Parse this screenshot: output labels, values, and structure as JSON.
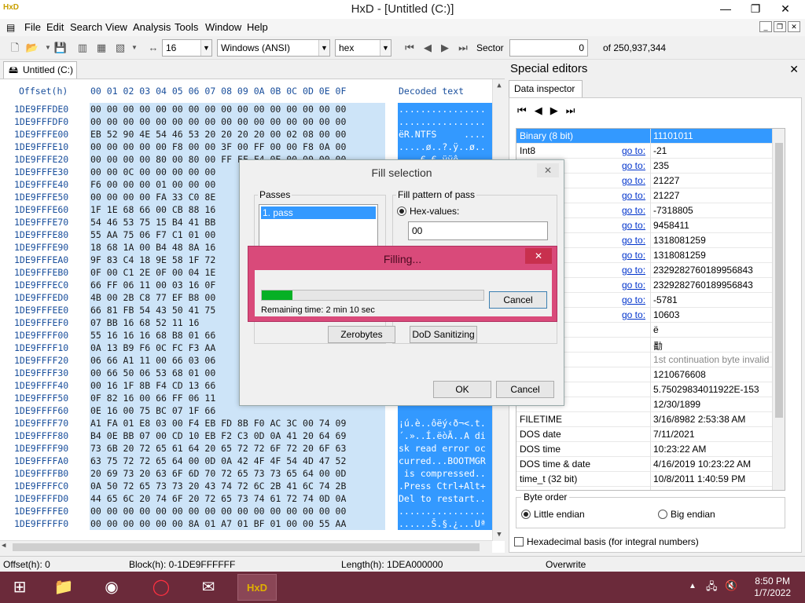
{
  "window": {
    "title": "HxD - [Untitled (C:)]",
    "app_icon": "HxD",
    "controls": {
      "minimize": "—",
      "restore": "❐",
      "close": "✕"
    }
  },
  "menu": [
    "File",
    "Edit",
    "Search",
    "View",
    "Analysis",
    "Tools",
    "Window",
    "Help"
  ],
  "toolbar": {
    "bytes_per_row": "16",
    "charset": "Windows (ANSI)",
    "offset_base": "hex",
    "sector_label": "Sector",
    "sector_value": "0",
    "sector_total": "of 250,937,344"
  },
  "document_tab": "Untitled (C:)",
  "hex": {
    "offset_header": "Offset(h)",
    "columns": "00 01 02 03 04 05 06 07 08 09 0A 0B 0C 0D 0E 0F",
    "decoded_header": "Decoded text",
    "rows": [
      {
        "offset": "1DE9FFFDE0",
        "bytes": "00 00 00 00 00 00 00 00 00 00 00 00 00 00 00 00",
        "text": "................"
      },
      {
        "offset": "1DE9FFFDF0",
        "bytes": "00 00 00 00 00 00 00 00 00 00 00 00 00 00 00 00",
        "text": "................"
      },
      {
        "offset": "1DE9FFFE00",
        "bytes": "EB 52 90 4E 54 46 53 20 20 20 20 00 02 08 00 00",
        "text": "ëR.NTFS     ...."
      },
      {
        "offset": "1DE9FFFE10",
        "bytes": "00 00 00 00 00 F8 00 00 3F 00 FF 00 00 F8 0A 00",
        "text": ".....ø..?.ÿ..ø.."
      },
      {
        "offset": "1DE9FFFE20",
        "bytes": "00 00 00 00 80 00 80 00 FF FF F4 0E 00 00 00 00",
        "text": "....€.€.ÿÿô....."
      },
      {
        "offset": "1DE9FFFE30",
        "bytes": "00 00 0C 00 00 00 00 00",
        "text": ""
      },
      {
        "offset": "1DE9FFFE40",
        "bytes": "F6 00 00 00 01 00 00 00",
        "text": ""
      },
      {
        "offset": "1DE9FFFE50",
        "bytes": "00 00 00 00 FA 33 C0 8E",
        "text": ""
      },
      {
        "offset": "1DE9FFFE60",
        "bytes": "1F 1E 68 66 00 CB 88 16",
        "text": ""
      },
      {
        "offset": "1DE9FFFE70",
        "bytes": "54 46 53 75 15 B4 41 BB",
        "text": ""
      },
      {
        "offset": "1DE9FFFE80",
        "bytes": "55 AA 75 06 F7 C1 01 00",
        "text": ""
      },
      {
        "offset": "1DE9FFFE90",
        "bytes": "18 68 1A 00 B4 48 8A 16",
        "text": ""
      },
      {
        "offset": "1DE9FFFEA0",
        "bytes": "9F 83 C4 18 9E 58 1F 72",
        "text": ""
      },
      {
        "offset": "1DE9FFFEB0",
        "bytes": "0F 00 C1 2E 0F 00 04 1E",
        "text": ""
      },
      {
        "offset": "1DE9FFFEC0",
        "bytes": "66 FF 06 11 00 03 16 0F",
        "text": ""
      },
      {
        "offset": "1DE9FFFED0",
        "bytes": "4B 00 2B C8 77 EF B8 00",
        "text": ""
      },
      {
        "offset": "1DE9FFFEE0",
        "bytes": "66 81 FB 54 43 50 41 75",
        "text": ""
      },
      {
        "offset": "1DE9FFFEF0",
        "bytes": "07 BB 16 68 52 11 16",
        "text": ""
      },
      {
        "offset": "1DE9FFFF00",
        "bytes": "55 16 16 16 68 B8 01 66",
        "text": ""
      },
      {
        "offset": "1DE9FFFF10",
        "bytes": "0A 13 B9 F6 0C FC F3 AA",
        "text": ""
      },
      {
        "offset": "1DE9FFFF20",
        "bytes": "06 66 A1 11 00 66 03 06",
        "text": ""
      },
      {
        "offset": "1DE9FFFF30",
        "bytes": "00 66 50 06 53 68 01 00",
        "text": ""
      },
      {
        "offset": "1DE9FFFF40",
        "bytes": "00 16 1F 8B F4 CD 13 66",
        "text": ""
      },
      {
        "offset": "1DE9FFFF50",
        "bytes": "0F 82 16 00 66 FF 06 11",
        "text": ""
      },
      {
        "offset": "1DE9FFFF60",
        "bytes": "0E 16 00 75 BC 07 1F 66",
        "text": ""
      },
      {
        "offset": "1DE9FFFF70",
        "bytes": "A1 FA 01 E8 03 00 F4 EB FD 8B F0 AC 3C 00 74 09",
        "text": "¡ú.è..ôëý‹ð¬<.t."
      },
      {
        "offset": "1DE9FFFF80",
        "bytes": "B4 0E BB 07 00 CD 10 EB F2 C3 0D 0A 41 20 64 69",
        "text": "´.»..Í.ëòÃ..A di"
      },
      {
        "offset": "1DE9FFFF90",
        "bytes": "73 6B 20 72 65 61 64 20 65 72 72 6F 72 20 6F 63",
        "text": "sk read error oc"
      },
      {
        "offset": "1DE9FFFFA0",
        "bytes": "63 75 72 72 65 64 00 0D 0A 42 4F 4F 54 4D 47 52",
        "text": "curred...BOOTMGR"
      },
      {
        "offset": "1DE9FFFFB0",
        "bytes": "20 69 73 20 63 6F 6D 70 72 65 73 73 65 64 00 0D",
        "text": " is compressed.."
      },
      {
        "offset": "1DE9FFFFC0",
        "bytes": "0A 50 72 65 73 73 20 43 74 72 6C 2B 41 6C 74 2B",
        "text": ".Press Ctrl+Alt+"
      },
      {
        "offset": "1DE9FFFFD0",
        "bytes": "44 65 6C 20 74 6F 20 72 65 73 74 61 72 74 0D 0A",
        "text": "Del to restart.."
      },
      {
        "offset": "1DE9FFFFE0",
        "bytes": "00 00 00 00 00 00 00 00 00 00 00 00 00 00 00 00",
        "text": "................"
      },
      {
        "offset": "1DE9FFFFF0",
        "bytes": "00 00 00 00 00 00 8A 01 A7 01 BF 01 00 00 55 AA",
        "text": "......Š.§.¿...Uª"
      }
    ]
  },
  "special_editors": {
    "title": "Special editors",
    "tab": "Data inspector",
    "goto": "go to:",
    "rows": [
      {
        "name": "Binary (8 bit)",
        "goto": false,
        "value": "11101011"
      },
      {
        "name": "Int8",
        "goto": true,
        "value": "-21"
      },
      {
        "name": "",
        "goto": true,
        "value": "235"
      },
      {
        "name": "",
        "goto": true,
        "value": "21227"
      },
      {
        "name": "",
        "goto": true,
        "value": "21227"
      },
      {
        "name": "",
        "goto": true,
        "value": "-7318805"
      },
      {
        "name": "",
        "goto": true,
        "value": "9458411"
      },
      {
        "name": "",
        "goto": true,
        "value": "1318081259"
      },
      {
        "name": "",
        "goto": true,
        "value": "1318081259"
      },
      {
        "name": "",
        "goto": true,
        "value": "2329282760189956843"
      },
      {
        "name": "",
        "goto": true,
        "value": "2329282760189956843"
      },
      {
        "name": "",
        "goto": true,
        "value": "-5781"
      },
      {
        "name": "",
        "goto": true,
        "value": "10603"
      },
      {
        "name": "char8_t",
        "goto": false,
        "value": "ë"
      },
      {
        "name": "char16_t",
        "goto": false,
        "value": "勫"
      },
      {
        "name": "point",
        "goto": false,
        "value": "1st continuation byte invalid",
        "dim": true
      },
      {
        "name": "32)",
        "goto": false,
        "value": "1210676608"
      },
      {
        "name": "at64)",
        "goto": false,
        "value": "5.75029834011922E-153"
      },
      {
        "name": "",
        "goto": false,
        "value": "12/30/1899"
      },
      {
        "name": "FILETIME",
        "goto": false,
        "value": "3/16/8982 2:53:38 AM"
      },
      {
        "name": "DOS date",
        "goto": false,
        "value": "7/11/2021"
      },
      {
        "name": "DOS time",
        "goto": false,
        "value": "10:23:22 AM"
      },
      {
        "name": "DOS time & date",
        "goto": false,
        "value": "4/16/2019 10:23:22 AM"
      },
      {
        "name": "time_t (32 bit)",
        "goto": false,
        "value": "10/8/2011 1:40:59 PM"
      },
      {
        "name": "time_t (64 bit)",
        "goto": false,
        "value": "Invalid",
        "dim": true
      }
    ],
    "byte_order_label": "Byte order",
    "little_endian": "Little endian",
    "big_endian": "Big endian",
    "hex_basis": "Hexadecimal basis (for integral numbers)"
  },
  "fill_dialog": {
    "title": "Fill selection",
    "passes_label": "Passes",
    "pass_item": "1. pass",
    "pattern_label": "Fill pattern of pass",
    "hex_values_label": "Hex-values:",
    "hex_value": "00",
    "zerobytes": "Zerobytes",
    "dod": "DoD Sanitizing",
    "ok": "OK",
    "cancel": "Cancel"
  },
  "filling_dialog": {
    "title": "Filling...",
    "progress": 0.14,
    "remaining": "Remaining time: 2 min 10 sec",
    "cancel": "Cancel"
  },
  "status": {
    "offset": "Offset(h): 0",
    "block": "Block(h): 0-1DE9FFFFFF",
    "length": "Length(h): 1DEA000000",
    "mode": "Overwrite"
  },
  "clock": {
    "time": "8:50 PM",
    "date": "1/7/2022"
  },
  "taskbar_apps": [
    "windows-logo",
    "file-explorer",
    "chrome",
    "opera",
    "thunderbird",
    "hxd"
  ]
}
